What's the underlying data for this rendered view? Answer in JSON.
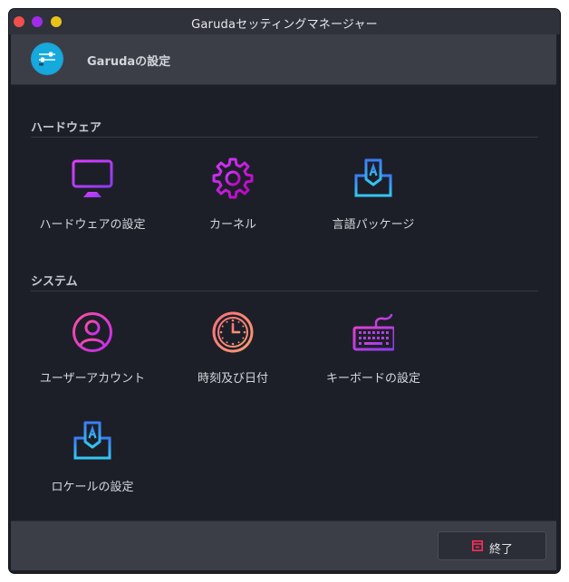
{
  "window": {
    "title": "Garudaセッティングマネージャー"
  },
  "header": {
    "title": "Garudaの設定",
    "icon": "settings-sliders-icon"
  },
  "sections": [
    {
      "label": "ハードウェア",
      "items": [
        {
          "label": "ハードウェアの設定",
          "icon": "monitor-icon"
        },
        {
          "label": "カーネル",
          "icon": "gear-icon"
        },
        {
          "label": "言語パッケージ",
          "icon": "language-package-icon"
        }
      ]
    },
    {
      "label": "システム",
      "items": [
        {
          "label": "ユーザーアカウント",
          "icon": "user-icon"
        },
        {
          "label": "時刻及び日付",
          "icon": "clock-icon"
        },
        {
          "label": "キーボードの設定",
          "icon": "keyboard-icon"
        },
        {
          "label": "ロケールの設定",
          "icon": "locale-icon"
        }
      ]
    }
  ],
  "footer": {
    "quit_label": "終了",
    "quit_icon": "exit-icon"
  },
  "colors": {
    "background": "#1c1f28",
    "header": "#3b3e47",
    "accent_magenta": "#c43cf0",
    "accent_blue": "#3aa6f0",
    "accent_red": "#ff2c5a"
  }
}
